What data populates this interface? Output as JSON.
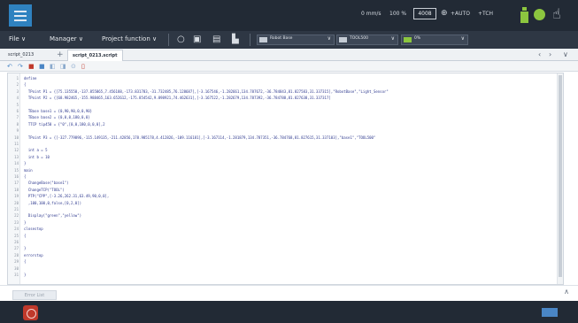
{
  "header": {
    "speed": "0 mm/s",
    "ratio": "100 %",
    "mode_value": "4008",
    "tool_label": "+AUTO",
    "tcp_label": "+TCH"
  },
  "toolbar": {
    "file": "File ∨",
    "manager": "Manager ∨",
    "project_function": "Project function ∨",
    "robot_select": "Robot Base",
    "tool_select": "TOOL500",
    "third_select": "0%"
  },
  "tabs": {
    "tab1": "script_0213",
    "tab2": "script_0213.script"
  },
  "code": [
    {
      "n": "1",
      "t": "define"
    },
    {
      "n": "2",
      "t": "{"
    },
    {
      "n": "3",
      "t": "  TPoint P1 = {[75.135558,-137.855865,7.456188,-173.831783,-31.732485,76.128687],[-3.167546,-1.282661,134.787672,-36.784843,81.827583,31.337315],\"RobotBase\",\"Light_Sensor\""
    },
    {
      "n": "4",
      "t": "  TPoint P2 = {[68.982465,-155.988465,163.652612,-175.854542,9.898921,74.462631],[-3.167522,-1.282679,134.787392,-36.784788,81.827638,31.337317]"
    },
    {
      "n": "5",
      "t": ""
    },
    {
      "n": "6",
      "t": "  TBase base1 = {0,90,90,0,0,90}"
    },
    {
      "n": "7",
      "t": "  TBase base2 = {0,0,0,180,0,0}"
    },
    {
      "n": "8",
      "t": "  TTCP tip450 = {\"0\",[0,0,180,0,0,0],2"
    },
    {
      "n": "9",
      "t": ""
    },
    {
      "n": "10",
      "t": "  TPoint P3 = {[-327.779896,-115.149135,-211.42856,178.985178,4.412826,-109.116181],[-3.167114,-1.281879,134.787351,-36.784768,81.827615,31.337103],\"base1\",\"TOOL500\""
    },
    {
      "n": "11",
      "t": ""
    },
    {
      "n": "12",
      "t": "  int a = 5"
    },
    {
      "n": "13",
      "t": "  int b = 10"
    },
    {
      "n": "14",
      "t": "}"
    },
    {
      "n": "15",
      "t": "main"
    },
    {
      "n": "16",
      "t": "{"
    },
    {
      "n": "17",
      "t": "  ChangeBase(\"base1\")"
    },
    {
      "n": "18",
      "t": "  ChangeTCP(\"TOOL\")"
    },
    {
      "n": "19",
      "t": "  PTP(\"CPP\",[-3.26,262.31,63.49,90,0,0],"
    },
    {
      "n": "20",
      "t": "  ,100,100,0,false,[0,2,0])"
    },
    {
      "n": "21",
      "t": ""
    },
    {
      "n": "22",
      "t": "  Display(\"green\",\"yellow\")"
    },
    {
      "n": "23",
      "t": "}"
    },
    {
      "n": "24",
      "t": "closestop"
    },
    {
      "n": "25",
      "t": "{"
    },
    {
      "n": "26",
      "t": ""
    },
    {
      "n": "27",
      "t": "}"
    },
    {
      "n": "28",
      "t": "errorstop"
    },
    {
      "n": "29",
      "t": "{"
    },
    {
      "n": "30",
      "t": ""
    },
    {
      "n": "31",
      "t": "}"
    }
  ],
  "footer": {
    "error_tab": "Error List"
  },
  "colors": {
    "topbar": "#222a35",
    "accent": "#2f82c0",
    "status_green": "#8cc63f",
    "estop_red": "#c0392b"
  }
}
